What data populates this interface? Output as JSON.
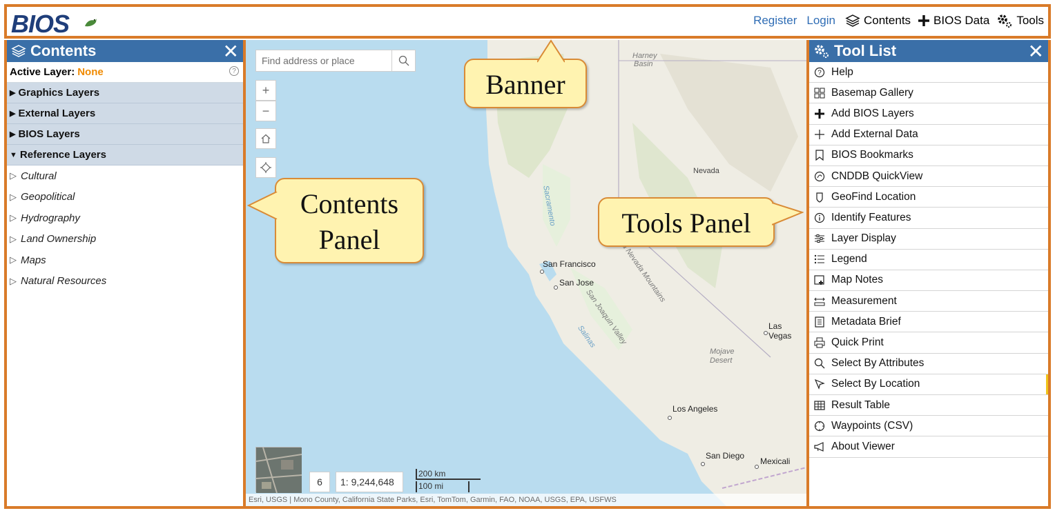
{
  "banner": {
    "logo_text": "BIOS",
    "links": {
      "register": "Register",
      "login": "Login"
    },
    "buttons": {
      "contents": "Contents",
      "bios_data": "BIOS Data",
      "tools": "Tools"
    }
  },
  "contents_panel": {
    "title": "Contents",
    "close": "✕",
    "active_layer_label": "Active Layer:",
    "active_layer_value": "None",
    "groups": [
      {
        "label": "Graphics Layers",
        "expanded": false
      },
      {
        "label": "External Layers",
        "expanded": false
      },
      {
        "label": "BIOS Layers",
        "expanded": false
      },
      {
        "label": "Reference Layers",
        "expanded": true
      }
    ],
    "reference_sublayers": [
      "Cultural",
      "Geopolitical",
      "Hydrography",
      "Land Ownership",
      "Maps",
      "Natural Resources"
    ]
  },
  "map": {
    "search_placeholder": "Find address or place",
    "zoom_level": "6",
    "scale_text": "1: 9,244,648",
    "scalebar_km": "200 km",
    "scalebar_mi": "100 mi",
    "attribution": "Esri, USGS | Mono County, California State Parks, Esri, TomTom, Garmin, FAO, NOAA, USGS, EPA, USFWS",
    "places": {
      "harney": "Harney",
      "harney2": "Basin",
      "nevada": "Nevada",
      "sacramento": "Sacramento",
      "san_francisco": "San Francisco",
      "san_jose": "San Jose",
      "sierra": "ra Nevada Mountains",
      "joaquin": "San Joaquin Valley",
      "salinas": "Salinas",
      "las_vegas": "Las Vegas",
      "mojave": "Mojave",
      "desert": "Desert",
      "los_angeles": "Los Angeles",
      "san_diego": "San Diego",
      "mexicali": "Mexicali"
    }
  },
  "tools_panel": {
    "title": "Tool List",
    "close": "✕",
    "items": [
      {
        "label": "Help",
        "icon": "help-icon"
      },
      {
        "label": "Basemap Gallery",
        "icon": "basemap-icon"
      },
      {
        "label": " Add BIOS Layers",
        "icon": "plus-bold-icon"
      },
      {
        "label": "Add External Data",
        "icon": "plus-icon"
      },
      {
        "label": "BIOS Bookmarks",
        "icon": "bookmark-icon"
      },
      {
        "label": "CNDDB QuickView",
        "icon": "cnddb-icon"
      },
      {
        "label": "GeoFind Location",
        "icon": "geofind-icon"
      },
      {
        "label": "Identify Features",
        "icon": "info-icon"
      },
      {
        "label": "Layer Display",
        "icon": "sliders-icon"
      },
      {
        "label": "Legend",
        "icon": "legend-icon"
      },
      {
        "label": "Map Notes",
        "icon": "notes-icon"
      },
      {
        "label": "Measurement",
        "icon": "measure-icon"
      },
      {
        "label": "Metadata Brief",
        "icon": "document-icon"
      },
      {
        "label": "Quick Print",
        "icon": "print-icon"
      },
      {
        "label": "Select By Attributes",
        "icon": "search-icon"
      },
      {
        "label": "Select By Location",
        "icon": "cursor-icon"
      },
      {
        "label": "Result Table",
        "icon": "table-icon"
      },
      {
        "label": "Waypoints (CSV)",
        "icon": "waypoint-icon"
      },
      {
        "label": "About Viewer",
        "icon": "megaphone-icon"
      }
    ]
  },
  "callouts": {
    "banner": "Banner",
    "contents_line1": "Contents",
    "contents_line2": "Panel",
    "tools": "Tools Panel"
  },
  "colors": {
    "accent_orange": "#d97b29",
    "panel_header": "#3a6fa8",
    "active_none": "#f08a00",
    "callout_fill": "#fff3b0"
  }
}
